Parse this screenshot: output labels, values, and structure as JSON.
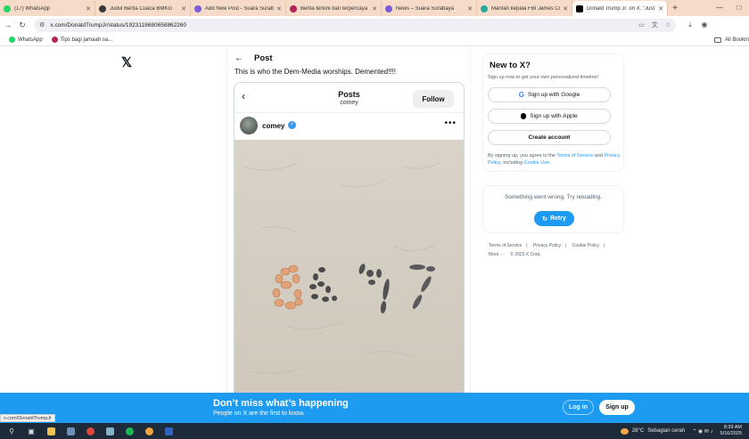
{
  "tabs": [
    {
      "title": "(17) WhatsApp",
      "color": "#25d366"
    },
    {
      "title": "Judul Berita Cuaca BMKG",
      "color": "#3a3a3a"
    },
    {
      "title": "Add New Post - Suara Surabaya",
      "color": "#7b5cd6"
    },
    {
      "title": "Berita terkini dan terpercaya in",
      "color": "#b3285a"
    },
    {
      "title": "News – Suara Surabaya",
      "color": "#7b5cd6"
    },
    {
      "title": "Mantan kepala FBI James Comey",
      "color": "#26a7a0"
    },
    {
      "title": "Donald Trump Jr. on X: \"Just av",
      "color": "#000000"
    }
  ],
  "address": {
    "url": "x.com/DonaldTrumpJr/status/1923118680658862260"
  },
  "bookmarks": {
    "whatsapp": "WhatsApp",
    "tips": "Tips bagi jamaah sa...",
    "all": "All Bookm"
  },
  "post": {
    "header_title": "Post",
    "text": "This is who the Dem-Media worships. Demented!!!!"
  },
  "embed": {
    "title": "Posts",
    "subtitle": "comey",
    "follow": "Follow",
    "username": "comey",
    "verified_icon": "verified-badge-icon",
    "photo_caption_text": "8647"
  },
  "signup": {
    "title": "New to X?",
    "subtitle": "Sign up now to get your own personalized timeline!",
    "google": "Sign up with Google",
    "apple": "Sign up with Apple",
    "create": "Create account",
    "terms_pre": "By signing up, you agree to the ",
    "terms_link": "Terms of Service",
    "terms_and": " and ",
    "privacy_link": "Privacy Policy",
    "terms_mid": ", including ",
    "cookie_link": "Cookie Use",
    "terms_end": "."
  },
  "error_card": {
    "message": "Something went wrong. Try reloading.",
    "retry": "Retry"
  },
  "footer": {
    "terms": "Terms of Service",
    "sep": "|",
    "privacy": "Privacy Policy",
    "cookie": "Cookie Policy",
    "more": "More ···",
    "copyright": "© 2025 X Corp."
  },
  "banner": {
    "headline": "Don’t miss what’s happening",
    "subline": "People on X are the first to know.",
    "login": "Log in",
    "signup": "Sign up"
  },
  "status_url": "x.com/DonaldTrumpJr",
  "taskbar": {
    "temperature": "28°C",
    "weather": "Sebagian cerah",
    "time": "8:39 AM",
    "date": "5/16/2025"
  },
  "colors": {
    "x_blue": "#1d9bf0",
    "ig_verified": "#3897f0"
  }
}
